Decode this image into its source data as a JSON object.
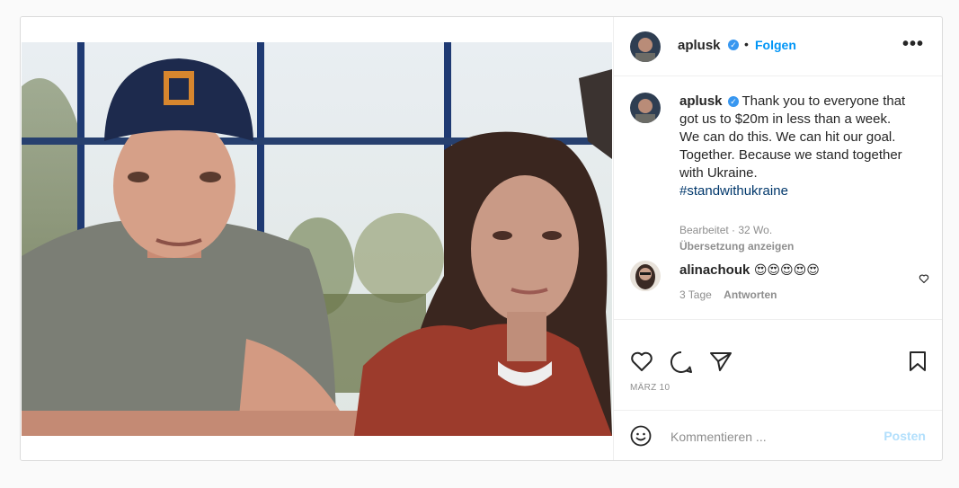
{
  "post": {
    "author": "aplusk",
    "follow_label": "Folgen",
    "separator": "•",
    "more_label": "•••",
    "verified_symbol": "✓",
    "caption": {
      "text": "Thank you to everyone that got us to $20m in less than a week. We can do this. We can hit our goal. Together. Because we stand together with Ukraine.",
      "hashtag": "#standwithukraine"
    },
    "edited_label": "Bearbeitet · 32 Wo.",
    "translation_label": "Übersetzung anzeigen",
    "comments": [
      {
        "user": "alinachouk",
        "text": "😍😍😍😍😍",
        "time": "3 Tage",
        "reply_label": "Antworten"
      }
    ],
    "date": "MÄRZ 10",
    "comment_placeholder": "Kommentieren ...",
    "post_button": "Posten"
  },
  "icons": {
    "like": "heart-icon",
    "comment": "comment-icon",
    "share": "paper-plane-icon",
    "save": "bookmark-icon",
    "emoji": "smiley-icon",
    "more": "more-options-icon",
    "verified": "verified-badge-icon"
  },
  "colors": {
    "link_blue": "#0095f6",
    "verified_blue": "#3897f0",
    "hashtag": "#00376b",
    "muted": "#8e8e8e",
    "post_disabled": "#b2dffc"
  }
}
